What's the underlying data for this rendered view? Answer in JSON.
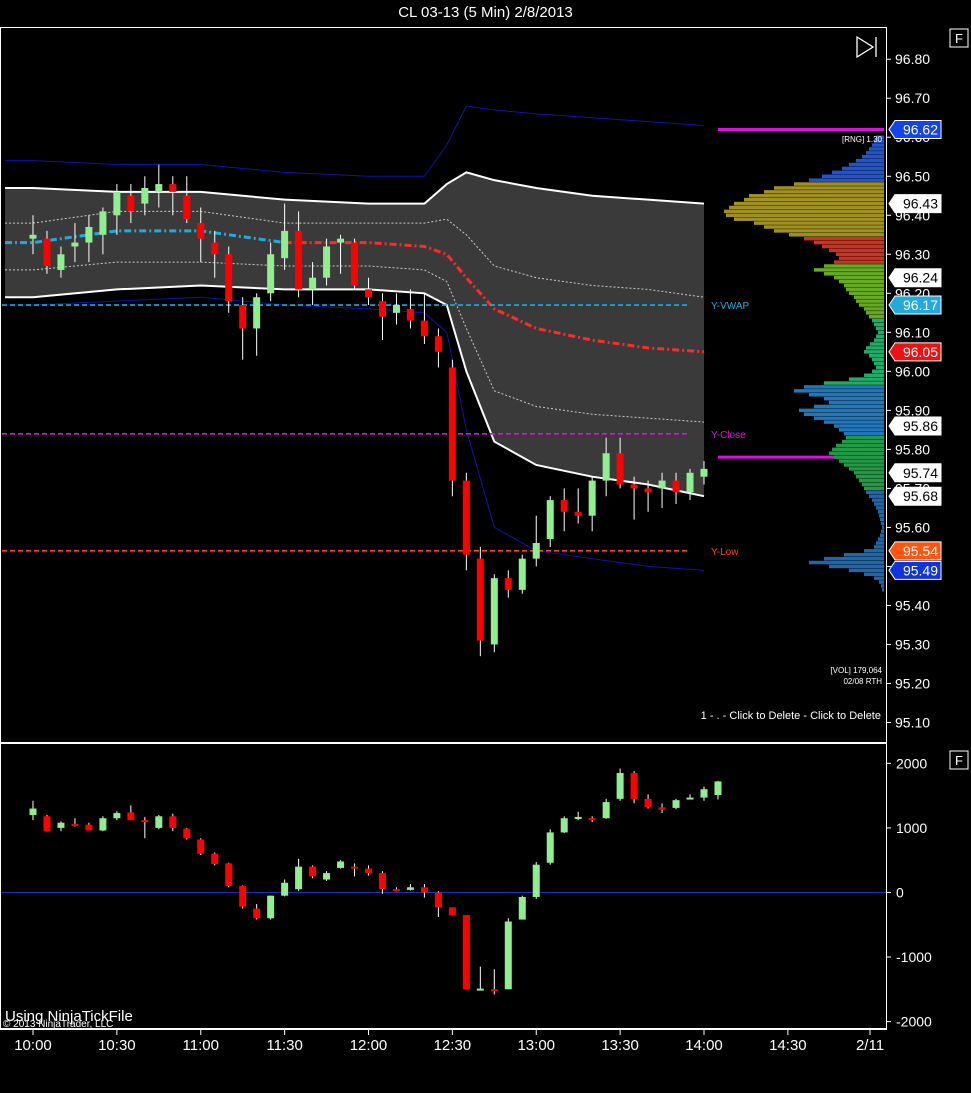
{
  "title": "CL 03-13 (5 Min)  2/8/2013",
  "panel_buttons": {
    "upper": "F",
    "lower": "F"
  },
  "icons": {
    "play_to_end": "play-to-end-icon"
  },
  "colors": {
    "up_candle": "#90ee90",
    "down_candle": "#ff0000",
    "vwap_center": "#ff2a2a",
    "band_fill": "#3a3a3a",
    "outer_band": "#1111aa",
    "y_vwap": "#22aadd",
    "y_close": "#dd11dd",
    "y_low": "#ff4411",
    "rng_line": "#dd11dd"
  },
  "price_labels": [
    {
      "value": "96.62",
      "bg": "#1144ee",
      "fg": "#ffffff",
      "border": "#ffffff"
    },
    {
      "value": "96.43",
      "bg": "#ffffff",
      "fg": "#000000",
      "border": "#ffffff"
    },
    {
      "value": "96.24",
      "bg": "#ffffff",
      "fg": "#000000",
      "border": "#ffffff"
    },
    {
      "value": "96.17",
      "bg": "#22aadd",
      "fg": "#ffffff",
      "border": "#ffffff"
    },
    {
      "value": "96.05",
      "bg": "#ee1111",
      "fg": "#ffffff",
      "border": "#ffffff"
    },
    {
      "value": "95.86",
      "bg": "#ffffff",
      "fg": "#000000",
      "border": "#ffffff"
    },
    {
      "value": "95.74",
      "bg": "#ffffff",
      "fg": "#000000",
      "border": "#ffffff"
    },
    {
      "value": "95.68",
      "bg": "#ffffff",
      "fg": "#000000",
      "border": "#ffffff"
    },
    {
      "value": "95.54",
      "bg": "#ff5511",
      "fg": "#ffffff",
      "border": "#ffffff"
    },
    {
      "value": "95.49",
      "bg": "#1133dd",
      "fg": "#ffffff",
      "border": "#ffffff"
    }
  ],
  "annotations": {
    "rng": "[RNG] 1.30",
    "vol": "[VOL] 179,064",
    "vol_sub": "02/08 RTH",
    "click_delete": "1 - . - Click to Delete - Click to Delete",
    "ninja_file": "Using NinjaTickFile",
    "copyright": "© 2013 NinjaTrader, LLC"
  },
  "chart_data": [
    {
      "type": "candlestick",
      "panel": "price",
      "title": "CL 03-13 (5 Min)  2/8/2013",
      "ylim": [
        95.05,
        96.88
      ],
      "y_ticks": [
        "96.80",
        "96.70",
        "96.60",
        "96.50",
        "96.40",
        "96.30",
        "96.20",
        "96.10",
        "96.00",
        "95.90",
        "95.80",
        "95.70",
        "95.60",
        "95.50",
        "95.40",
        "95.30",
        "95.20",
        "95.10"
      ],
      "x_ticks": [
        "10:00",
        "10:30",
        "11:00",
        "11:30",
        "12:00",
        "12:30",
        "13:00",
        "13:30",
        "14:00",
        "14:30",
        "2/11"
      ],
      "x_tick_minutes": [
        0,
        30,
        60,
        90,
        120,
        150,
        180,
        210,
        240,
        270,
        300
      ],
      "grid": false,
      "candles": [
        {
          "t": 0,
          "o": 96.34,
          "h": 96.4,
          "l": 96.3,
          "c": 96.35
        },
        {
          "t": 5,
          "o": 96.34,
          "h": 96.36,
          "l": 96.25,
          "c": 96.27
        },
        {
          "t": 10,
          "o": 96.26,
          "h": 96.32,
          "l": 96.24,
          "c": 96.3
        },
        {
          "t": 15,
          "o": 96.32,
          "h": 96.38,
          "l": 96.28,
          "c": 96.33
        },
        {
          "t": 20,
          "o": 96.33,
          "h": 96.4,
          "l": 96.28,
          "c": 96.37
        },
        {
          "t": 25,
          "o": 96.35,
          "h": 96.42,
          "l": 96.3,
          "c": 96.41
        },
        {
          "t": 30,
          "o": 96.4,
          "h": 96.48,
          "l": 96.35,
          "c": 96.46
        },
        {
          "t": 35,
          "o": 96.45,
          "h": 96.48,
          "l": 96.38,
          "c": 96.41
        },
        {
          "t": 40,
          "o": 96.43,
          "h": 96.5,
          "l": 96.4,
          "c": 96.47
        },
        {
          "t": 45,
          "o": 96.46,
          "h": 96.53,
          "l": 96.42,
          "c": 96.48
        },
        {
          "t": 50,
          "o": 96.48,
          "h": 96.5,
          "l": 96.4,
          "c": 96.46
        },
        {
          "t": 55,
          "o": 96.45,
          "h": 96.5,
          "l": 96.38,
          "c": 96.39
        },
        {
          "t": 60,
          "o": 96.38,
          "h": 96.42,
          "l": 96.28,
          "c": 96.34
        },
        {
          "t": 65,
          "o": 96.33,
          "h": 96.36,
          "l": 96.24,
          "c": 96.3
        },
        {
          "t": 70,
          "o": 96.3,
          "h": 96.32,
          "l": 96.15,
          "c": 96.18
        },
        {
          "t": 75,
          "o": 96.17,
          "h": 96.19,
          "l": 96.03,
          "c": 96.11
        },
        {
          "t": 80,
          "o": 96.11,
          "h": 96.2,
          "l": 96.04,
          "c": 96.19
        },
        {
          "t": 85,
          "o": 96.2,
          "h": 96.33,
          "l": 96.18,
          "c": 96.3
        },
        {
          "t": 90,
          "o": 96.29,
          "h": 96.43,
          "l": 96.26,
          "c": 96.36
        },
        {
          "t": 95,
          "o": 96.36,
          "h": 96.41,
          "l": 96.19,
          "c": 96.21
        },
        {
          "t": 100,
          "o": 96.21,
          "h": 96.28,
          "l": 96.17,
          "c": 96.24
        },
        {
          "t": 105,
          "o": 96.24,
          "h": 96.34,
          "l": 96.22,
          "c": 96.32
        },
        {
          "t": 110,
          "o": 96.33,
          "h": 96.35,
          "l": 96.25,
          "c": 96.34
        },
        {
          "t": 115,
          "o": 96.33,
          "h": 96.34,
          "l": 96.21,
          "c": 96.22
        },
        {
          "t": 120,
          "o": 96.21,
          "h": 96.24,
          "l": 96.17,
          "c": 96.19
        },
        {
          "t": 125,
          "o": 96.18,
          "h": 96.2,
          "l": 96.08,
          "c": 96.14
        },
        {
          "t": 130,
          "o": 96.15,
          "h": 96.2,
          "l": 96.12,
          "c": 96.17
        },
        {
          "t": 135,
          "o": 96.16,
          "h": 96.21,
          "l": 96.11,
          "c": 96.13
        },
        {
          "t": 140,
          "o": 96.13,
          "h": 96.2,
          "l": 96.07,
          "c": 96.09
        },
        {
          "t": 145,
          "o": 96.09,
          "h": 96.11,
          "l": 96.01,
          "c": 96.05
        },
        {
          "t": 150,
          "o": 96.01,
          "h": 96.03,
          "l": 95.68,
          "c": 95.72
        },
        {
          "t": 155,
          "o": 95.72,
          "h": 95.74,
          "l": 95.49,
          "c": 95.53
        },
        {
          "t": 160,
          "o": 95.52,
          "h": 95.55,
          "l": 95.27,
          "c": 95.31
        },
        {
          "t": 165,
          "o": 95.3,
          "h": 95.48,
          "l": 95.28,
          "c": 95.47
        },
        {
          "t": 170,
          "o": 95.47,
          "h": 95.49,
          "l": 95.42,
          "c": 95.44
        },
        {
          "t": 175,
          "o": 95.44,
          "h": 95.53,
          "l": 95.43,
          "c": 95.52
        },
        {
          "t": 180,
          "o": 95.52,
          "h": 95.63,
          "l": 95.5,
          "c": 95.56
        },
        {
          "t": 185,
          "o": 95.57,
          "h": 95.68,
          "l": 95.55,
          "c": 95.67
        },
        {
          "t": 190,
          "o": 95.67,
          "h": 95.7,
          "l": 95.59,
          "c": 95.64
        },
        {
          "t": 195,
          "o": 95.64,
          "h": 95.7,
          "l": 95.61,
          "c": 95.63
        },
        {
          "t": 200,
          "o": 95.63,
          "h": 95.73,
          "l": 95.59,
          "c": 95.72
        },
        {
          "t": 205,
          "o": 95.72,
          "h": 95.83,
          "l": 95.68,
          "c": 95.79
        },
        {
          "t": 210,
          "o": 95.79,
          "h": 95.83,
          "l": 95.7,
          "c": 95.71
        },
        {
          "t": 215,
          "o": 95.71,
          "h": 95.73,
          "l": 95.62,
          "c": 95.7
        },
        {
          "t": 220,
          "o": 95.7,
          "h": 95.72,
          "l": 95.64,
          "c": 95.69
        },
        {
          "t": 225,
          "o": 95.7,
          "h": 95.74,
          "l": 95.65,
          "c": 95.72
        },
        {
          "t": 230,
          "o": 95.72,
          "h": 95.74,
          "l": 95.66,
          "c": 95.69
        },
        {
          "t": 235,
          "o": 95.69,
          "h": 95.75,
          "l": 95.67,
          "c": 95.74
        },
        {
          "t": 240,
          "o": 95.73,
          "h": 95.77,
          "l": 95.71,
          "c": 95.75
        }
      ],
      "vwap_band": {
        "t": [
          -10,
          0,
          30,
          60,
          90,
          120,
          140,
          148,
          155,
          165,
          180,
          200,
          220,
          240
        ],
        "center": [
          96.33,
          96.33,
          96.36,
          96.36,
          96.33,
          96.33,
          96.32,
          96.3,
          96.24,
          96.16,
          96.11,
          96.08,
          96.06,
          96.05
        ],
        "upper": [
          96.47,
          96.47,
          96.46,
          96.46,
          96.44,
          96.43,
          96.43,
          96.48,
          96.51,
          96.49,
          96.47,
          96.45,
          96.44,
          96.43
        ],
        "inner_upper": [
          96.38,
          96.38,
          96.41,
          96.41,
          96.38,
          96.38,
          96.38,
          96.39,
          96.35,
          96.27,
          96.24,
          96.22,
          96.21,
          96.19
        ],
        "inner_lower": [
          96.26,
          96.26,
          96.28,
          96.28,
          96.27,
          96.27,
          96.26,
          96.23,
          96.11,
          95.95,
          95.91,
          95.89,
          95.88,
          95.87
        ],
        "lower": [
          96.19,
          96.19,
          96.21,
          96.22,
          96.21,
          96.21,
          96.2,
          96.17,
          96.0,
          95.82,
          95.76,
          95.73,
          95.71,
          95.68
        ],
        "outer_upper": [
          96.54,
          96.54,
          96.53,
          96.53,
          96.51,
          96.5,
          96.5,
          96.58,
          96.68,
          96.67,
          96.66,
          96.65,
          96.64,
          96.63
        ],
        "outer_lower": [
          96.17,
          96.17,
          96.18,
          96.19,
          96.17,
          96.16,
          96.15,
          96.1,
          95.85,
          95.6,
          95.54,
          95.52,
          95.5,
          95.49
        ]
      },
      "levels": [
        {
          "name": "Y-VWAP",
          "value": 96.17,
          "style": "dashed"
        },
        {
          "name": "Y-Close",
          "value": 95.84,
          "style": "dashed"
        },
        {
          "name": "Y-Low",
          "value": 95.54,
          "style": "dashed"
        }
      ],
      "range_lines": [
        96.62,
        95.78
      ],
      "volume_profile": {
        "price_top": 96.6,
        "price_step": 0.01,
        "lengths": [
          8,
          10,
          12,
          15,
          18,
          22,
          28,
          35,
          42,
          52,
          62,
          75,
          90,
          110,
          120,
          135,
          140,
          150,
          155,
          160,
          158,
          150,
          130,
          120,
          110,
          95,
          80,
          70,
          62,
          55,
          48,
          45,
          50,
          60,
          70,
          60,
          50,
          45,
          40,
          38,
          35,
          30,
          28,
          25,
          20,
          18,
          15,
          12,
          10,
          8,
          6,
          8,
          10,
          14,
          18,
          20,
          15,
          12,
          10,
          8,
          12,
          20,
          35,
          60,
          80,
          90,
          75,
          60,
          55,
          70,
          85,
          80,
          70,
          60,
          50,
          45,
          40,
          38,
          42,
          48,
          52,
          55,
          50,
          45,
          40,
          35,
          30,
          28,
          25,
          22,
          20,
          18,
          15,
          12,
          10,
          8,
          6,
          5,
          4,
          3,
          2,
          3,
          4,
          6,
          8,
          10,
          20,
          40,
          60,
          75,
          55,
          35,
          20,
          10,
          5,
          3,
          2
        ]
      }
    },
    {
      "type": "candlestick",
      "panel": "indicator",
      "ylim": [
        -2100,
        2300
      ],
      "y_ticks": [
        "2000",
        "1000",
        "0",
        "-1000",
        "-2000"
      ],
      "y_tick_values": [
        2000,
        1000,
        0,
        -1000,
        -2000
      ],
      "zero_line": 0,
      "candles": [
        {
          "t": 0,
          "o": 1200,
          "h": 1420,
          "l": 1120,
          "c": 1300
        },
        {
          "t": 5,
          "o": 1180,
          "h": 1200,
          "l": 950,
          "c": 950
        },
        {
          "t": 10,
          "o": 1000,
          "h": 1100,
          "l": 950,
          "c": 1080
        },
        {
          "t": 15,
          "o": 1060,
          "h": 1150,
          "l": 1020,
          "c": 1040
        },
        {
          "t": 20,
          "o": 1050,
          "h": 1080,
          "l": 960,
          "c": 960
        },
        {
          "t": 25,
          "o": 960,
          "h": 1180,
          "l": 950,
          "c": 1150
        },
        {
          "t": 30,
          "o": 1150,
          "h": 1260,
          "l": 1120,
          "c": 1230
        },
        {
          "t": 35,
          "o": 1240,
          "h": 1350,
          "l": 1190,
          "c": 1120
        },
        {
          "t": 40,
          "o": 1120,
          "h": 1170,
          "l": 840,
          "c": 1100
        },
        {
          "t": 45,
          "o": 1000,
          "h": 1200,
          "l": 980,
          "c": 1180
        },
        {
          "t": 50,
          "o": 1180,
          "h": 1220,
          "l": 950,
          "c": 1000
        },
        {
          "t": 55,
          "o": 990,
          "h": 1000,
          "l": 820,
          "c": 840
        },
        {
          "t": 60,
          "o": 820,
          "h": 840,
          "l": 580,
          "c": 600
        },
        {
          "t": 65,
          "o": 600,
          "h": 620,
          "l": 420,
          "c": 440
        },
        {
          "t": 70,
          "o": 450,
          "h": 460,
          "l": 80,
          "c": 100
        },
        {
          "t": 75,
          "o": 100,
          "h": 110,
          "l": -250,
          "c": -220
        },
        {
          "t": 80,
          "o": -250,
          "h": -180,
          "l": -420,
          "c": -400
        },
        {
          "t": 85,
          "o": -400,
          "h": -50,
          "l": -420,
          "c": -50
        },
        {
          "t": 90,
          "o": -50,
          "h": 200,
          "l": -60,
          "c": 150
        },
        {
          "t": 95,
          "o": 50,
          "h": 520,
          "l": 20,
          "c": 400
        },
        {
          "t": 100,
          "o": 400,
          "h": 420,
          "l": 220,
          "c": 250
        },
        {
          "t": 105,
          "o": 200,
          "h": 330,
          "l": 180,
          "c": 300
        },
        {
          "t": 110,
          "o": 380,
          "h": 500,
          "l": 370,
          "c": 480
        },
        {
          "t": 115,
          "o": 400,
          "h": 450,
          "l": 250,
          "c": 370
        },
        {
          "t": 120,
          "o": 370,
          "h": 420,
          "l": 260,
          "c": 300
        },
        {
          "t": 125,
          "o": 300,
          "h": 330,
          "l": -20,
          "c": 50
        },
        {
          "t": 130,
          "o": 50,
          "h": 80,
          "l": 20,
          "c": 40
        },
        {
          "t": 135,
          "o": 40,
          "h": 130,
          "l": 30,
          "c": 80
        },
        {
          "t": 140,
          "o": 80,
          "h": 130,
          "l": -80,
          "c": 0
        },
        {
          "t": 145,
          "o": 0,
          "h": 20,
          "l": -380,
          "c": -230
        },
        {
          "t": 150,
          "o": -230,
          "h": -250,
          "l": -330,
          "c": -350
        },
        {
          "t": 155,
          "o": -350,
          "h": -360,
          "l": -1500,
          "c": -1500
        },
        {
          "t": 160,
          "o": -1500,
          "h": -1150,
          "l": -1500,
          "c": -1490
        },
        {
          "t": 165,
          "o": -1500,
          "h": -1190,
          "l": -1580,
          "c": -1510
        },
        {
          "t": 170,
          "o": -1500,
          "h": -400,
          "l": -1500,
          "c": -450
        },
        {
          "t": 175,
          "o": -420,
          "h": -50,
          "l": -420,
          "c": -70
        },
        {
          "t": 180,
          "o": -70,
          "h": 470,
          "l": -100,
          "c": 430
        },
        {
          "t": 185,
          "o": 460,
          "h": 980,
          "l": 430,
          "c": 930
        },
        {
          "t": 190,
          "o": 930,
          "h": 1180,
          "l": 920,
          "c": 1150
        },
        {
          "t": 195,
          "o": 1150,
          "h": 1250,
          "l": 1120,
          "c": 1170
        },
        {
          "t": 200,
          "o": 1150,
          "h": 1180,
          "l": 1090,
          "c": 1130
        },
        {
          "t": 205,
          "o": 1150,
          "h": 1450,
          "l": 1140,
          "c": 1400
        },
        {
          "t": 210,
          "o": 1450,
          "h": 1920,
          "l": 1420,
          "c": 1850
        },
        {
          "t": 215,
          "o": 1850,
          "h": 1880,
          "l": 1380,
          "c": 1450
        },
        {
          "t": 220,
          "o": 1450,
          "h": 1520,
          "l": 1300,
          "c": 1320
        },
        {
          "t": 225,
          "o": 1320,
          "h": 1380,
          "l": 1230,
          "c": 1280
        },
        {
          "t": 230,
          "o": 1310,
          "h": 1450,
          "l": 1290,
          "c": 1430
        },
        {
          "t": 235,
          "o": 1460,
          "h": 1520,
          "l": 1440,
          "c": 1470
        },
        {
          "t": 240,
          "o": 1470,
          "h": 1640,
          "l": 1420,
          "c": 1600
        },
        {
          "t": 245,
          "o": 1510,
          "h": 1730,
          "l": 1440,
          "c": 1720
        }
      ]
    }
  ]
}
